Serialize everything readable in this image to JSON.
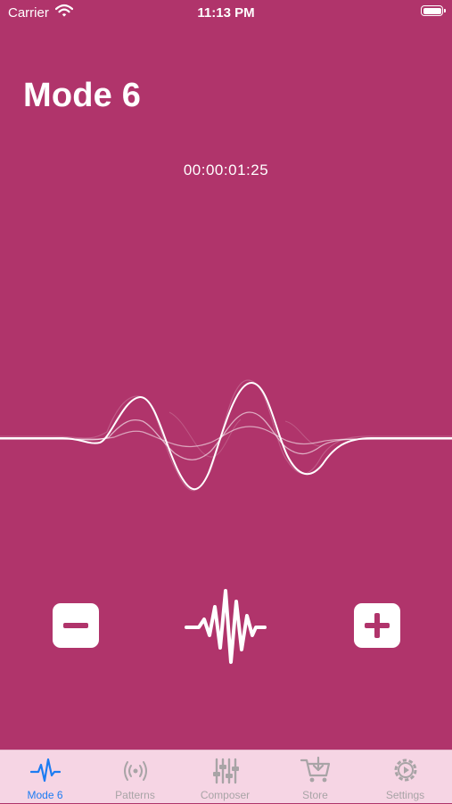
{
  "status_bar": {
    "carrier": "Carrier",
    "time": "11:13 PM"
  },
  "header": {
    "title": "Mode 6"
  },
  "timer": {
    "elapsed": "00:00:01:25"
  },
  "controls": {
    "decrease_icon": "minus-icon",
    "pulse_icon": "vibration-pulse-icon",
    "increase_icon": "plus-icon"
  },
  "tab_bar": {
    "active_color": "#1d7cf2",
    "inactive_color": "#a8a4a6",
    "items": [
      {
        "label": "Mode 6",
        "icon": "heartbeat-icon",
        "active": true
      },
      {
        "label": "Patterns",
        "icon": "broadcast-icon",
        "active": false
      },
      {
        "label": "Composer",
        "icon": "sliders-icon",
        "active": false
      },
      {
        "label": "Store",
        "icon": "cart-icon",
        "active": false
      },
      {
        "label": "Settings",
        "icon": "gear-icon",
        "active": false
      }
    ]
  },
  "theme": {
    "background": "#b0346b",
    "tab_bar_background": "#f6d5e4"
  }
}
